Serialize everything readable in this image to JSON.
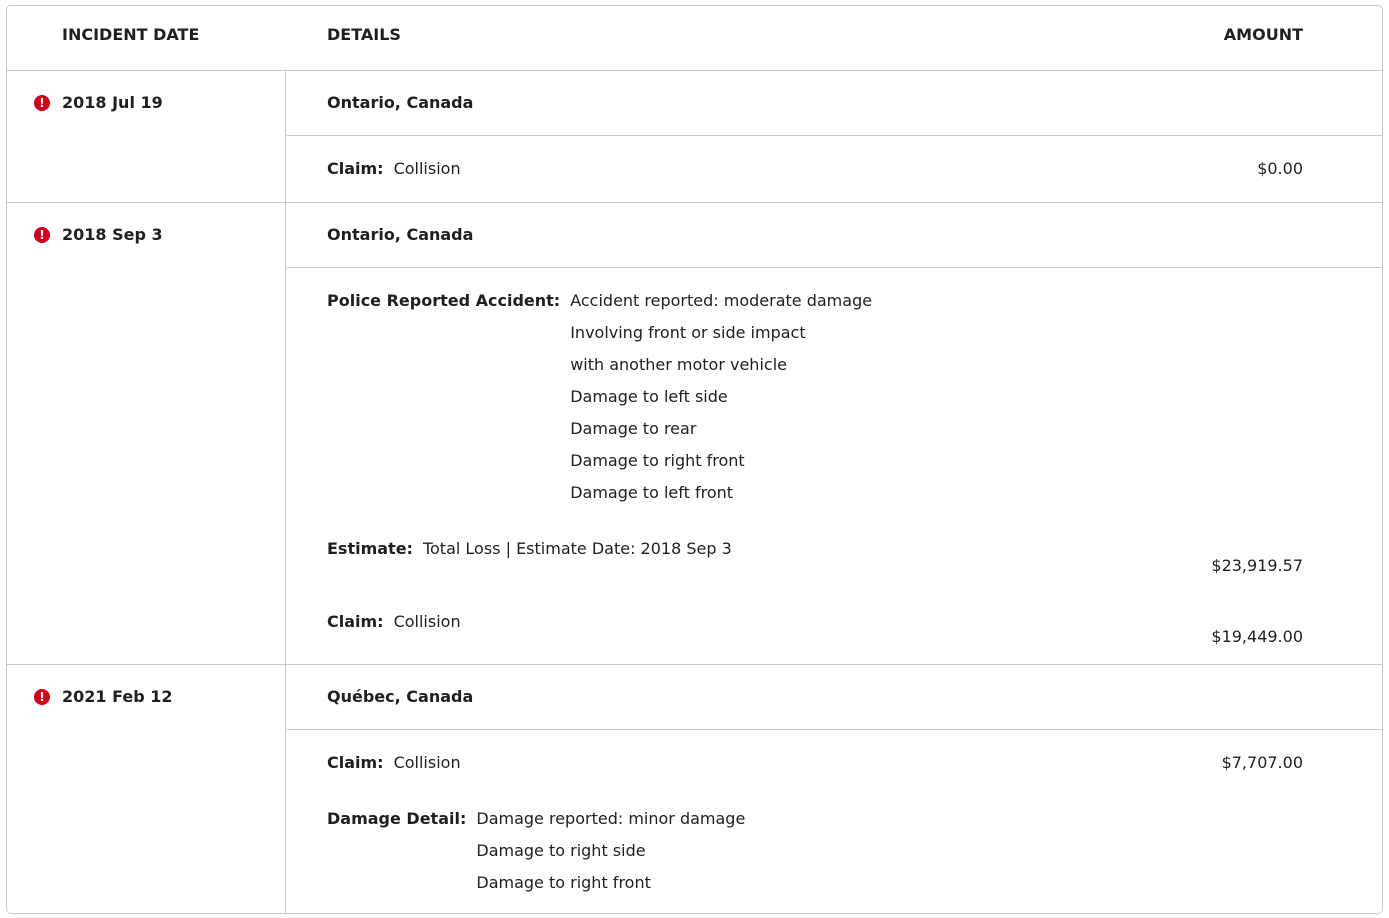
{
  "header": {
    "incident_date": "INCIDENT DATE",
    "details": "DETAILS",
    "amount": "AMOUNT"
  },
  "alert_icon_color": "#d0021b",
  "alert_glyph": "!",
  "incidents": [
    {
      "date": "2018 Jul 19",
      "location": "Ontario, Canada",
      "claim_label": "Claim:",
      "claim_value": "Collision",
      "claim_amount": "$0.00"
    },
    {
      "date": "2018 Sep 3",
      "location": "Ontario, Canada",
      "police_label": "Police Reported Accident:",
      "police_lines": [
        "Accident reported: moderate damage",
        "Involving front or side impact",
        "with another motor vehicle",
        "Damage to left side",
        "Damage to rear",
        "Damage to right front",
        "Damage to left front"
      ],
      "estimate_label": "Estimate:",
      "estimate_value": "Total Loss | Estimate Date: 2018 Sep 3",
      "estimate_amount": "$23,919.57",
      "claim_label": "Claim:",
      "claim_value": "Collision",
      "claim_amount": "$19,449.00"
    },
    {
      "date": "2021 Feb 12",
      "location": "Québec, Canada",
      "claim_label": "Claim:",
      "claim_value": "Collision",
      "claim_amount": "$7,707.00",
      "damage_label": "Damage Detail:",
      "damage_lines": [
        "Damage reported: minor damage",
        "Damage to right side",
        "Damage to right front"
      ]
    }
  ]
}
